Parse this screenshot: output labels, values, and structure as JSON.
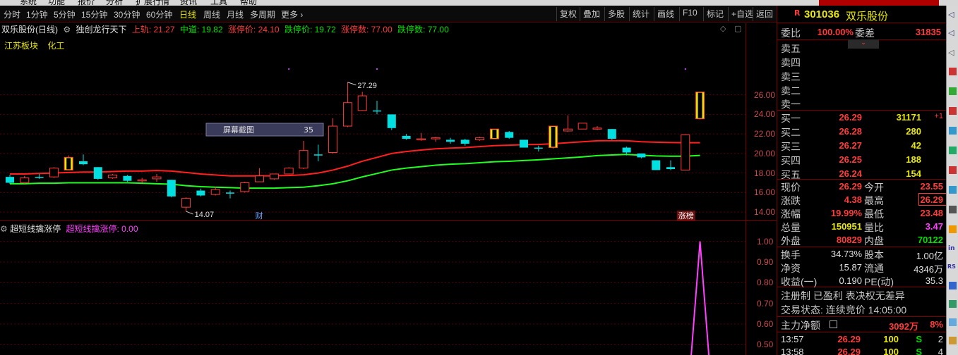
{
  "topmenu": [
    "系统",
    "功能",
    "报价",
    "分析",
    "扩展行情",
    "资讯",
    "工具",
    "帮助"
  ],
  "toolbar": {
    "periods": [
      "分时",
      "1分钟",
      "5分钟",
      "15分钟",
      "30分钟",
      "60分钟",
      "日线",
      "周线",
      "月线",
      "多周期",
      "更多 ›"
    ],
    "active_period": "日线",
    "right_buttons": [
      "复权",
      "叠加",
      "多股",
      "统计",
      "画线",
      "F10",
      "标记",
      "+自选",
      "返回"
    ]
  },
  "chart_header": {
    "stock": "双乐股份(日线)",
    "indicator": "独创龙行天下",
    "upper_label": "上轨: 21.27",
    "mid_label": "中道: 19.82",
    "limit_up_label": "涨停价: 24.10",
    "limit_down_label": "跌停价: 19.72",
    "limit_up_count_label": "涨停数: 77.00",
    "limit_down_count_label": "跌停数: 77.00",
    "sector": [
      "江苏板块",
      "化工"
    ]
  },
  "indicator_header": {
    "name": "超短线擒涨停",
    "value_label": "超短线擒涨停: 0.00"
  },
  "annotations": {
    "high": "27.29",
    "low": "14.07",
    "fin_tag": "财",
    "limit_tag": "涨榜",
    "screenshot_label": "屏幕截图",
    "screenshot_num": "35"
  },
  "colors": {
    "up": "#ff3c3c",
    "down": "#00e0e0",
    "yellow": "#e9e900",
    "green": "#00e000",
    "magenta": "#ff40ff",
    "axis": "#c84b4b"
  },
  "chart_data": {
    "type": "candlestick",
    "ylim": [
      13.5,
      28.5
    ],
    "yticks": [
      14.0,
      16.0,
      18.0,
      20.0,
      22.0,
      24.0,
      26.0
    ],
    "candles": [
      {
        "o": 17.6,
        "h": 17.8,
        "l": 16.9,
        "c": 17.0,
        "col": "cyan"
      },
      {
        "o": 17.0,
        "h": 17.7,
        "l": 16.9,
        "c": 17.5,
        "col": "red"
      },
      {
        "o": 17.6,
        "h": 17.9,
        "l": 17.4,
        "c": 17.6,
        "col": "cyan"
      },
      {
        "o": 17.6,
        "h": 18.6,
        "l": 17.5,
        "c": 18.5,
        "col": "red"
      },
      {
        "o": 18.3,
        "h": 19.8,
        "l": 18.3,
        "c": 19.6,
        "col": "yellow"
      },
      {
        "o": 19.2,
        "h": 19.9,
        "l": 18.8,
        "c": 18.9,
        "col": "cyan"
      },
      {
        "o": 18.6,
        "h": 18.6,
        "l": 17.3,
        "c": 17.4,
        "col": "cyan"
      },
      {
        "o": 17.8,
        "h": 17.9,
        "l": 17.4,
        "c": 17.5,
        "col": "red"
      },
      {
        "o": 17.7,
        "h": 17.8,
        "l": 17.1,
        "c": 17.2,
        "col": "cyan"
      },
      {
        "o": 17.3,
        "h": 17.5,
        "l": 17.0,
        "c": 17.3,
        "col": "red"
      },
      {
        "o": 17.4,
        "h": 17.9,
        "l": 17.1,
        "c": 17.6,
        "col": "red"
      },
      {
        "o": 17.3,
        "h": 17.3,
        "l": 15.5,
        "c": 15.6,
        "col": "cyan"
      },
      {
        "o": 14.5,
        "h": 15.5,
        "l": 14.07,
        "c": 15.4,
        "col": "red"
      },
      {
        "o": 16.2,
        "h": 16.4,
        "l": 15.6,
        "c": 15.7,
        "col": "cyan"
      },
      {
        "o": 15.8,
        "h": 16.6,
        "l": 15.7,
        "c": 16.3,
        "col": "red"
      },
      {
        "o": 16.0,
        "h": 16.2,
        "l": 15.4,
        "c": 15.9,
        "col": "cyan"
      },
      {
        "o": 16.1,
        "h": 17.1,
        "l": 16.0,
        "c": 17.0,
        "col": "red"
      },
      {
        "o": 17.1,
        "h": 18.5,
        "l": 17.1,
        "c": 17.7,
        "col": "red"
      },
      {
        "o": 17.4,
        "h": 17.9,
        "l": 17.3,
        "c": 17.9,
        "col": "red"
      },
      {
        "o": 17.9,
        "h": 18.6,
        "l": 17.9,
        "c": 18.5,
        "col": "red"
      },
      {
        "o": 18.5,
        "h": 21.3,
        "l": 18.4,
        "c": 20.3,
        "col": "red"
      },
      {
        "o": 19.9,
        "h": 20.9,
        "l": 19.2,
        "c": 19.9,
        "col": "cyan"
      },
      {
        "o": 20.1,
        "h": 23.6,
        "l": 20.0,
        "c": 22.8,
        "col": "red"
      },
      {
        "o": 22.8,
        "h": 27.29,
        "l": 22.7,
        "c": 25.2,
        "col": "red"
      },
      {
        "o": 24.4,
        "h": 26.3,
        "l": 24.4,
        "c": 25.9,
        "col": "red"
      },
      {
        "o": 24.4,
        "h": 25.4,
        "l": 24.0,
        "c": 24.3,
        "col": "cyan"
      },
      {
        "o": 24.0,
        "h": 24.0,
        "l": 22.4,
        "c": 22.6,
        "col": "cyan"
      },
      {
        "o": 21.8,
        "h": 22.0,
        "l": 21.4,
        "c": 21.5,
        "col": "cyan"
      },
      {
        "o": 21.5,
        "h": 22.1,
        "l": 21.3,
        "c": 21.4,
        "col": "red"
      },
      {
        "o": 21.6,
        "h": 21.7,
        "l": 21.2,
        "c": 21.5,
        "col": "red"
      },
      {
        "o": 21.4,
        "h": 21.6,
        "l": 21.0,
        "c": 21.2,
        "col": "cyan"
      },
      {
        "o": 21.4,
        "h": 21.5,
        "l": 20.8,
        "c": 21.0,
        "col": "cyan"
      },
      {
        "o": 21.4,
        "h": 21.7,
        "l": 21.3,
        "c": 21.6,
        "col": "red"
      },
      {
        "o": 21.5,
        "h": 22.5,
        "l": 21.5,
        "c": 22.5,
        "col": "yellow"
      },
      {
        "o": 22.2,
        "h": 22.3,
        "l": 21.5,
        "c": 21.6,
        "col": "cyan"
      },
      {
        "o": 21.4,
        "h": 21.4,
        "l": 20.6,
        "c": 20.6,
        "col": "cyan"
      },
      {
        "o": 20.6,
        "h": 20.8,
        "l": 20.2,
        "c": 20.5,
        "col": "cyan"
      },
      {
        "o": 20.6,
        "h": 22.8,
        "l": 20.5,
        "c": 22.8,
        "col": "yellow"
      },
      {
        "o": 22.3,
        "h": 23.9,
        "l": 22.2,
        "c": 22.5,
        "col": "red"
      },
      {
        "o": 22.5,
        "h": 23.1,
        "l": 22.5,
        "c": 23.1,
        "col": "red"
      },
      {
        "o": 22.6,
        "h": 22.8,
        "l": 22.4,
        "c": 22.6,
        "col": "red"
      },
      {
        "o": 22.5,
        "h": 22.5,
        "l": 21.4,
        "c": 21.5,
        "col": "cyan"
      },
      {
        "o": 20.6,
        "h": 20.7,
        "l": 19.8,
        "c": 20.1,
        "col": "cyan"
      },
      {
        "o": 20.0,
        "h": 20.0,
        "l": 19.5,
        "c": 19.6,
        "col": "cyan"
      },
      {
        "o": 19.3,
        "h": 19.3,
        "l": 18.3,
        "c": 18.3,
        "col": "cyan"
      },
      {
        "o": 18.6,
        "h": 19.3,
        "l": 18.3,
        "c": 18.4,
        "col": "cyan"
      },
      {
        "o": 18.3,
        "h": 21.9,
        "l": 18.3,
        "c": 21.9,
        "col": "red"
      },
      {
        "o": 23.55,
        "h": 26.29,
        "l": 23.48,
        "c": 26.29,
        "col": "yellow"
      }
    ],
    "upper_band": [
      17.9,
      17.9,
      17.95,
      18.0,
      18.05,
      18.1,
      18.1,
      18.15,
      18.2,
      18.2,
      18.25,
      18.2,
      18.05,
      17.9,
      17.8,
      17.7,
      17.7,
      17.7,
      17.72,
      17.75,
      17.82,
      18.0,
      18.3,
      18.7,
      19.2,
      19.6,
      20.0,
      20.2,
      20.35,
      20.48,
      20.55,
      20.6,
      20.7,
      20.8,
      20.85,
      20.9,
      20.92,
      21.0,
      21.1,
      21.2,
      21.3,
      21.32,
      21.3,
      21.2,
      21.15,
      21.12,
      21.1,
      21.1
    ],
    "mid_band": [
      16.9,
      16.9,
      16.95,
      16.95,
      17.0,
      17.0,
      17.0,
      17.0,
      17.0,
      16.95,
      16.9,
      16.85,
      16.7,
      16.6,
      16.55,
      16.5,
      16.45,
      16.45,
      16.45,
      16.5,
      16.55,
      16.7,
      16.9,
      17.2,
      17.6,
      17.95,
      18.3,
      18.5,
      18.65,
      18.8,
      18.9,
      18.95,
      19.05,
      19.15,
      19.2,
      19.28,
      19.35,
      19.45,
      19.55,
      19.65,
      19.78,
      19.85,
      19.9,
      19.82,
      19.75,
      19.72,
      19.72,
      19.8
    ],
    "indicator": {
      "ylim": [
        0.45,
        1.05
      ],
      "yticks": [
        0.5,
        0.6,
        0.7,
        0.8,
        0.9,
        1.0
      ],
      "spike_index": 47,
      "spike_value": 1.0
    }
  },
  "quote": {
    "code": "301036",
    "name": "双乐股份",
    "weibi_label": "委比",
    "weibi": "100.00%",
    "weicha_label": "委差",
    "weicha": "31835",
    "sell": [
      {
        "label": "卖五"
      },
      {
        "label": "卖四"
      },
      {
        "label": "卖三"
      },
      {
        "label": "卖二"
      },
      {
        "label": "卖一"
      }
    ],
    "buy": [
      {
        "label": "买一",
        "price": "26.29",
        "vol": "31171",
        "chg": "+1"
      },
      {
        "label": "买二",
        "price": "26.28",
        "vol": "280",
        "chg": ""
      },
      {
        "label": "买三",
        "price": "26.27",
        "vol": "42",
        "chg": ""
      },
      {
        "label": "买四",
        "price": "26.25",
        "vol": "188",
        "chg": ""
      },
      {
        "label": "买五",
        "price": "26.24",
        "vol": "154",
        "chg": ""
      }
    ],
    "stats": [
      {
        "l1": "现价",
        "v1": "26.29",
        "c1": "red",
        "l2": "今开",
        "v2": "23.55",
        "c2": "red"
      },
      {
        "l1": "涨跌",
        "v1": "4.38",
        "c1": "red",
        "l2": "最高",
        "v2": "26.29",
        "c2": "red"
      },
      {
        "l1": "涨幅",
        "v1": "19.99%",
        "c1": "red",
        "l2": "最低",
        "v2": "23.48",
        "c2": "red"
      },
      {
        "l1": "总量",
        "v1": "150951",
        "c1": "yellow",
        "l2": "量比",
        "v2": "3.47",
        "c2": "mag"
      },
      {
        "l1": "外盘",
        "v1": "80829",
        "c1": "red",
        "l2": "内盘",
        "v2": "70122",
        "c2": "green"
      }
    ],
    "stats2": [
      {
        "l1": "换手",
        "v1": "34.73%",
        "l2": "股本",
        "v2": "1.00亿"
      },
      {
        "l1": "净资",
        "v1": "15.87",
        "l2": "流通",
        "v2": "4346万"
      },
      {
        "l1": "收益(一)",
        "v1": "0.190",
        "l2": "PE(动)",
        "v2": "35.3"
      }
    ],
    "note": "注册制 已盈利 表决权无差异",
    "trade_status": "交易状态: 连续竞价 14:05:00",
    "main_flow_label": "主力净额",
    "main_flow": "3092万",
    "main_flow_pct": "8%",
    "ticks": [
      {
        "t": "13:57",
        "p": "26.29",
        "v": "100",
        "d": "S",
        "n": "2"
      },
      {
        "t": "13:58",
        "p": "26.29",
        "v": "100",
        "d": "S",
        "n": "4"
      }
    ]
  }
}
